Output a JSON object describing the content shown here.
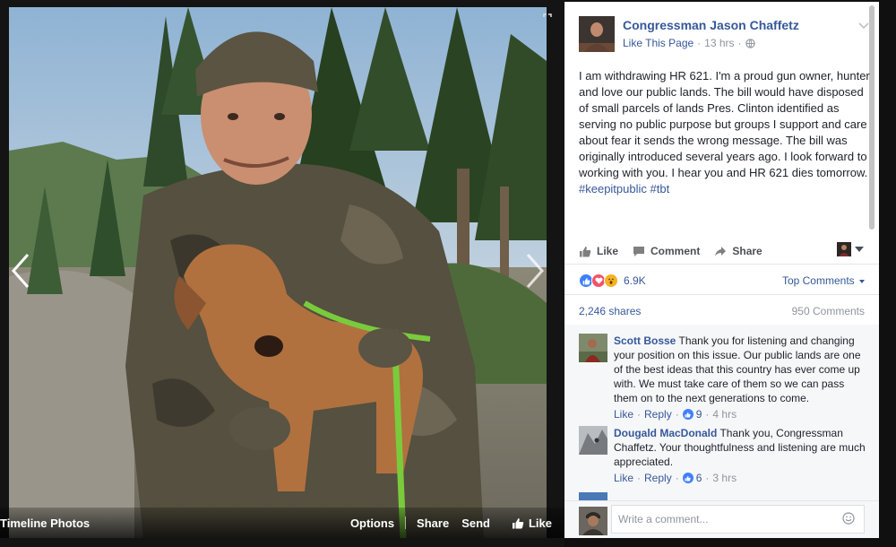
{
  "photo_viewer": {
    "album_title": "Timeline Photos",
    "actions": {
      "options": "Options",
      "share": "Share",
      "send": "Send",
      "like": "Like"
    }
  },
  "post": {
    "page_name": "Congressman Jason Chaffetz",
    "like_page": "Like This Page",
    "time": "13 hrs",
    "text_main": "I am withdrawing HR 621. I'm a proud gun owner, hunter and love our public lands. The bill would have disposed of small parcels of lands Pres. Clinton identified as serving no public purpose but groups I support and care about fear it sends the wrong message. The bill was originally introduced several years ago. I look forward to working with you. I hear you and HR 621 dies tomorrow.",
    "hashtag_1": "#keepitpublic",
    "hashtag_2": "#tbt"
  },
  "post_actions": {
    "like": "Like",
    "comment": "Comment",
    "share": "Share"
  },
  "stats": {
    "reaction_count": "6.9K",
    "top_comments": "Top Comments",
    "shares": "2,246 shares",
    "comments": "950 Comments"
  },
  "comments": [
    {
      "name": "Scott Bosse",
      "text": "Thank you for listening and changing your position on this issue. Our public lands are one of the best ideas that this country has ever come up with. We must take care of them so we can pass them on to the next generations to come.",
      "like": "Like",
      "reply": "Reply",
      "likes": "9",
      "time": "4 hrs"
    },
    {
      "name": "Dougald MacDonald",
      "text": "Thank you, Congressman Chaffetz. Your thoughtfulness and listening are much appreciated.",
      "like": "Like",
      "reply": "Reply",
      "likes": "6",
      "time": "3 hrs"
    }
  ],
  "composer": {
    "placeholder": "Write a comment..."
  },
  "colors": {
    "link": "#365899",
    "meta": "#90949c",
    "like_blue": "#4080ff",
    "love_red": "#f25268",
    "wow_yellow": "#f7b125"
  }
}
